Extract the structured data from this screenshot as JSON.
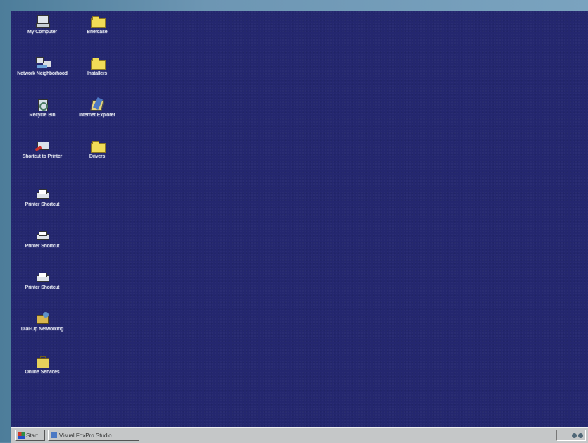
{
  "desktop": {
    "background_color": "#24276f",
    "icons": [
      {
        "label": "My Computer",
        "type": "computer-icon"
      },
      {
        "label": "Briefcase",
        "type": "folder-icon"
      },
      {
        "label": "Network Neighborhood",
        "type": "network-icon"
      },
      {
        "label": "Installers",
        "type": "folder-icon"
      },
      {
        "label": "Recycle Bin",
        "type": "recycle-bin-icon"
      },
      {
        "label": "Internet Explorer",
        "type": "internet-explorer-icon"
      },
      {
        "label": "Shortcut to Printer",
        "type": "shortcut-icon"
      },
      {
        "label": "Drivers",
        "type": "folder-icon"
      },
      {
        "label": "Printer Shortcut",
        "type": "printer-icon"
      },
      {
        "label": "Printer Shortcut",
        "type": "printer-icon"
      },
      {
        "label": "Printer Shortcut",
        "type": "printer-icon"
      },
      {
        "label": "Dial-Up Networking",
        "type": "connection-icon"
      },
      {
        "label": "Online Services",
        "type": "briefcase-icon"
      }
    ]
  },
  "taskbar": {
    "start_label": "Start",
    "task_label": "Visual FoxPro Studio",
    "tray_time": ""
  }
}
